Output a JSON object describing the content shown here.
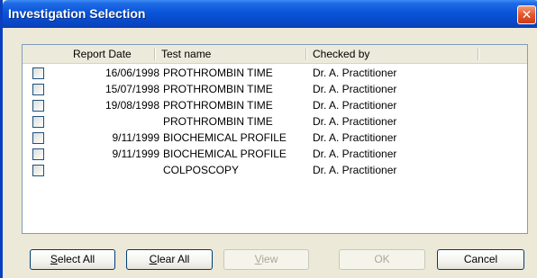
{
  "window": {
    "title": "Investigation Selection",
    "close_glyph": "✕"
  },
  "list": {
    "columns": [
      "Report Date",
      "Test name",
      "Checked by"
    ],
    "rows": [
      {
        "date": "16/06/1998",
        "test": "PROTHROMBIN TIME",
        "checked_by": "Dr. A. Practitioner",
        "checked": false
      },
      {
        "date": "15/07/1998",
        "test": "PROTHROMBIN TIME",
        "checked_by": "Dr. A. Practitioner",
        "checked": false
      },
      {
        "date": "19/08/1998",
        "test": "PROTHROMBIN TIME",
        "checked_by": "Dr. A. Practitioner",
        "checked": false
      },
      {
        "date": "",
        "test": "PROTHROMBIN TIME",
        "checked_by": "Dr. A. Practitioner",
        "checked": false
      },
      {
        "date": "9/11/1999",
        "test": "BIOCHEMICAL PROFILE",
        "checked_by": "Dr. A. Practitioner",
        "checked": false
      },
      {
        "date": "9/11/1999",
        "test": "BIOCHEMICAL PROFILE",
        "checked_by": "Dr. A. Practitioner",
        "checked": false
      },
      {
        "date": "",
        "test": "COLPOSCOPY",
        "checked_by": "Dr. A. Practitioner",
        "checked": false
      }
    ]
  },
  "buttons": {
    "select_all": {
      "first": "S",
      "rest": "elect All"
    },
    "clear_all": {
      "first": "C",
      "rest": "lear All"
    },
    "view": {
      "first": "V",
      "rest": "iew"
    },
    "ok": "OK",
    "cancel": "Cancel"
  },
  "colors": {
    "title_bar": "#0a55d9",
    "close_button": "#e6562c",
    "dialog_bg": "#ece9d8"
  }
}
